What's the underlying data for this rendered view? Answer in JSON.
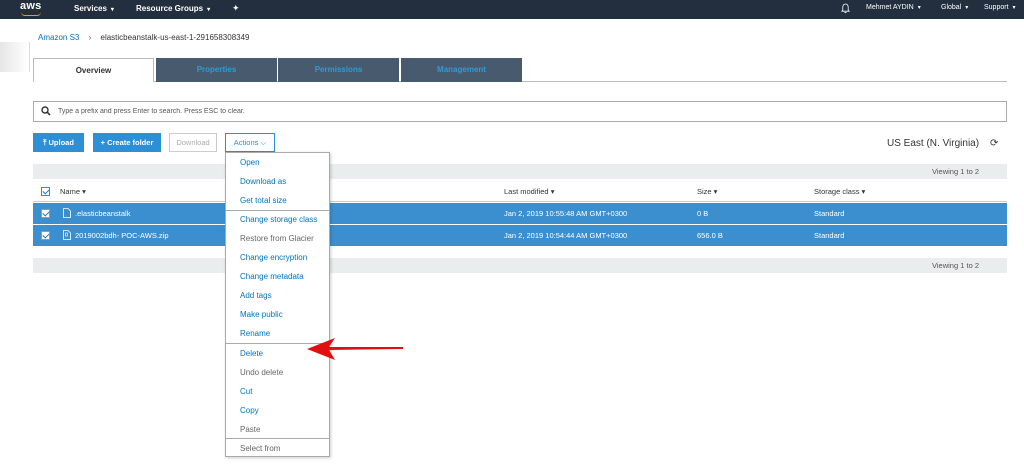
{
  "topnav": {
    "logo": "aws",
    "services": "Services",
    "resource_groups": "Resource Groups",
    "pin": "✦",
    "user": "Mehmet AYDIN",
    "region": "Global",
    "support": "Support",
    "caret": "▾"
  },
  "breadcrumb": {
    "root": "Amazon S3",
    "sep": "›",
    "bucket": "elasticbeanstalk-us-east-1-291658308349"
  },
  "tabs": [
    {
      "label": "Overview"
    },
    {
      "label": "Properties"
    },
    {
      "label": "Permissions"
    },
    {
      "label": "Management"
    }
  ],
  "search": {
    "placeholder": "Type a prefix and press Enter to search. Press ESC to clear."
  },
  "toolbar": {
    "upload": "Upload",
    "create_folder": "Create folder",
    "download": "Download",
    "actions": "Actions",
    "region": "US East (N. Virginia)"
  },
  "table": {
    "viewing_top": "Viewing 1 to 2",
    "viewing_bottom": "Viewing 1 to 2",
    "headers": {
      "name": "Name ▾",
      "last_modified": "Last modified ▾",
      "size": "Size ▾",
      "storage_class": "Storage class ▾"
    },
    "rows": [
      {
        "name": ".elasticbeanstalk",
        "last_modified": "Jan 2, 2019 10:55:48 AM GMT+0300",
        "size": "0 B",
        "storage_class": "Standard"
      },
      {
        "name": "2019002bdh-          POC-AWS.zip",
        "last_modified": "Jan 2, 2019 10:54:44 AM GMT+0300",
        "size": "656.0 B",
        "storage_class": "Standard"
      }
    ]
  },
  "actions_menu": {
    "items": [
      {
        "label": "Open",
        "enabled": true
      },
      {
        "label": "Download as",
        "enabled": true
      },
      {
        "label": "Get total size",
        "enabled": true
      },
      {
        "label": "Change storage class",
        "enabled": true
      },
      {
        "label": "Restore from Glacier",
        "enabled": false
      },
      {
        "label": "Change encryption",
        "enabled": true
      },
      {
        "label": "Change metadata",
        "enabled": true
      },
      {
        "label": "Add tags",
        "enabled": true
      },
      {
        "label": "Make public",
        "enabled": true
      },
      {
        "label": "Rename",
        "enabled": true
      },
      {
        "label": "Delete",
        "enabled": true
      },
      {
        "label": "Undo delete",
        "enabled": false
      },
      {
        "label": "Cut",
        "enabled": true
      },
      {
        "label": "Copy",
        "enabled": true
      },
      {
        "label": "Paste",
        "enabled": false
      },
      {
        "label": "Select from",
        "enabled": false
      }
    ]
  },
  "colors": {
    "nav_bg": "#232f3e",
    "accent": "#2d8fd6",
    "selected_row": "#3b8fcf",
    "annotation_arrow": "#e01010"
  }
}
